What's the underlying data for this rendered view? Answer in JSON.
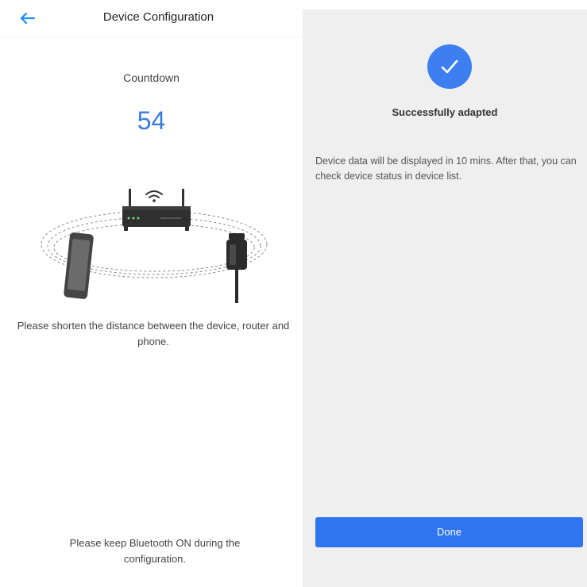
{
  "header": {
    "title": "Device Configuration",
    "back_icon": "arrow-left-icon",
    "accent_color": "#1a8cff"
  },
  "countdown": {
    "label": "Countdown",
    "value": "54",
    "color": "#3a7be0"
  },
  "illustration": {
    "icons": [
      "wifi-icon",
      "router-icon",
      "phone-icon",
      "device-icon"
    ]
  },
  "hint": "Please shorten the distance between the device, router and phone.",
  "bluetooth_notice": "Please keep Bluetooth ON during the configuration.",
  "success": {
    "icon": "check-circle-icon",
    "title": "Successfully adapted",
    "description": "Device data will be displayed in 10 mins. After that, you can check device status in device list.",
    "done_label": "Done",
    "button_color": "#2f74f0"
  }
}
